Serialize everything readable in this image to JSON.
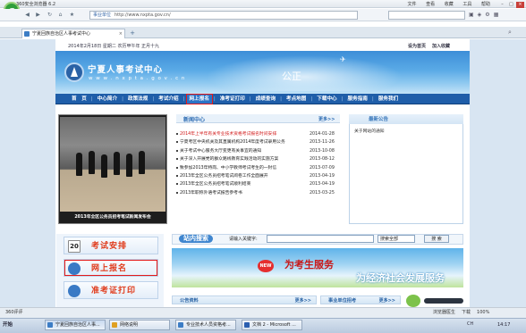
{
  "browser": {
    "app_name": "360安全浏览器 6.2",
    "menus": [
      "文件",
      "查看",
      "收藏",
      "工具",
      "帮助"
    ],
    "address_tag": "事业单位",
    "url": "http://www.nxpta.gov.cn/",
    "tab_title": "宁夏回族自治区人事考试中心",
    "tab_close": "×",
    "new_tab": "+"
  },
  "site": {
    "date_line": "2014年2月18日 星期二 农历甲午年 正月十九",
    "top_links": [
      "设为首页",
      "加入收藏"
    ],
    "name": "宁夏人事考试中心",
    "url_text": "w w w . n x p t a . g o v . c n",
    "banner_word": "公正",
    "nav": [
      "首　页",
      "中心简介",
      "政策法规",
      "考试介绍",
      "网上报名",
      "准考证打印",
      "成绩查询",
      "考点地图",
      "下载中心",
      "服务指南",
      "服务我们"
    ],
    "nav_highlight_index": 4
  },
  "photo": {
    "caption": "2013年全区公务员招考笔试新闻发布会"
  },
  "news": {
    "title": "新闻中心",
    "more": "更多>>",
    "items": [
      {
        "text": "2014年上半年有关专业技术资格考试报名时间安排",
        "date": "2014-01-28",
        "red": true
      },
      {
        "text": "宁夏考区中央机关及其直属机构2014年度考试录用公务",
        "date": "2013-11-26",
        "red": false
      },
      {
        "text": "关于考试中心服务大厅变更有关事宜的通知",
        "date": "2013-10-08",
        "red": false
      },
      {
        "text": "关于深入开展党的群众路线教育实践活动的实施方案",
        "date": "2013-08-12",
        "red": false
      },
      {
        "text": "致参加2013年特岗、中小学教师考试考生的一封信",
        "date": "2013-07-09",
        "red": false
      },
      {
        "text": "2013年全区公务员招考笔试阅卷工作全面展开",
        "date": "2013-04-19",
        "red": false
      },
      {
        "text": "2013年全区公务员招考笔试顺利结束",
        "date": "2013-04-19",
        "red": false
      },
      {
        "text": "2013年职称外语考试报告参考书",
        "date": "2013-03-25",
        "red": false
      }
    ]
  },
  "notice": {
    "title": "最新公告",
    "items": [
      "关于网站的通知"
    ]
  },
  "left_buttons": [
    {
      "label": "考试安排",
      "icon": "calendar-icon",
      "cal_number": "20"
    },
    {
      "label": "网上报名",
      "icon": "user-register-icon"
    },
    {
      "label": "准考证打印",
      "icon": "print-icon"
    }
  ],
  "search": {
    "title": "站内搜索",
    "label": "请输入关键字:",
    "select_value": "搜索全部",
    "button": "搜 索"
  },
  "promo": {
    "badge": "NEW",
    "line1": "为考生服务",
    "line2": "为经济社会发展服务"
  },
  "lower": {
    "box1_title": "公告资料",
    "box1_more": "更多>>",
    "box2_title": "事业单位招考",
    "box2_more": "更多>>"
  },
  "statusbar": {
    "left": "360评评",
    "right_items": [
      "浏览器医生",
      "下载",
      "100%"
    ]
  },
  "taskbar": {
    "start": "开始",
    "items": [
      {
        "label": "宁夏回族自治区人事...",
        "color": "#3c7dc5",
        "active": true
      },
      {
        "label": "网络说明",
        "color": "#e0a020",
        "active": false
      },
      {
        "label": "专业技术人员资格考...",
        "color": "#3c7dc5",
        "active": false
      },
      {
        "label": "文档 2 - Microsoft ...",
        "color": "#2b5fb0",
        "active": false
      }
    ],
    "tray": "CH",
    "clock": "14:17"
  }
}
